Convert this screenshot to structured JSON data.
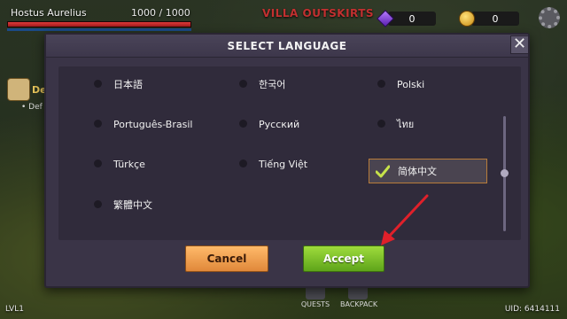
{
  "hud": {
    "player_name": "Hostus Aurelius",
    "hp_text": "1000 / 1000",
    "hp_fraction": 1.0,
    "location": "VILLA OUTSKIRTS",
    "gems": "0",
    "coins": "0",
    "side_quest_label": "De",
    "side_quest_sub": "• Def",
    "level": "LVL1",
    "uid": "UID: 6414111",
    "quests_label": "QUESTS",
    "backpack_label": "BACKPACK"
  },
  "modal": {
    "title": "SELECT LANGUAGE",
    "close_symbol": "✕",
    "languages": [
      {
        "label": "日本語",
        "selected": false
      },
      {
        "label": "한국어",
        "selected": false
      },
      {
        "label": "Polski",
        "selected": false
      },
      {
        "label": "Português-Brasil",
        "selected": false
      },
      {
        "label": "Русский",
        "selected": false
      },
      {
        "label": "ไทย",
        "selected": false
      },
      {
        "label": "Türkçe",
        "selected": false
      },
      {
        "label": "Tiếng Việt",
        "selected": false
      },
      {
        "label": "简体中文",
        "selected": true
      },
      {
        "label": "繁體中文",
        "selected": false
      }
    ],
    "cancel_label": "Cancel",
    "accept_label": "Accept"
  },
  "colors": {
    "accent_orange": "#b87c3a",
    "accept_green": "#6fb820",
    "cancel_orange": "#f0a050",
    "annotation_arrow": "#e0202a",
    "location_red": "#c23030"
  },
  "icons": [
    "gem-icon",
    "coin-icon",
    "settings-icon",
    "close-icon",
    "check-icon",
    "scroll-icon",
    "arrow-annotation"
  ]
}
